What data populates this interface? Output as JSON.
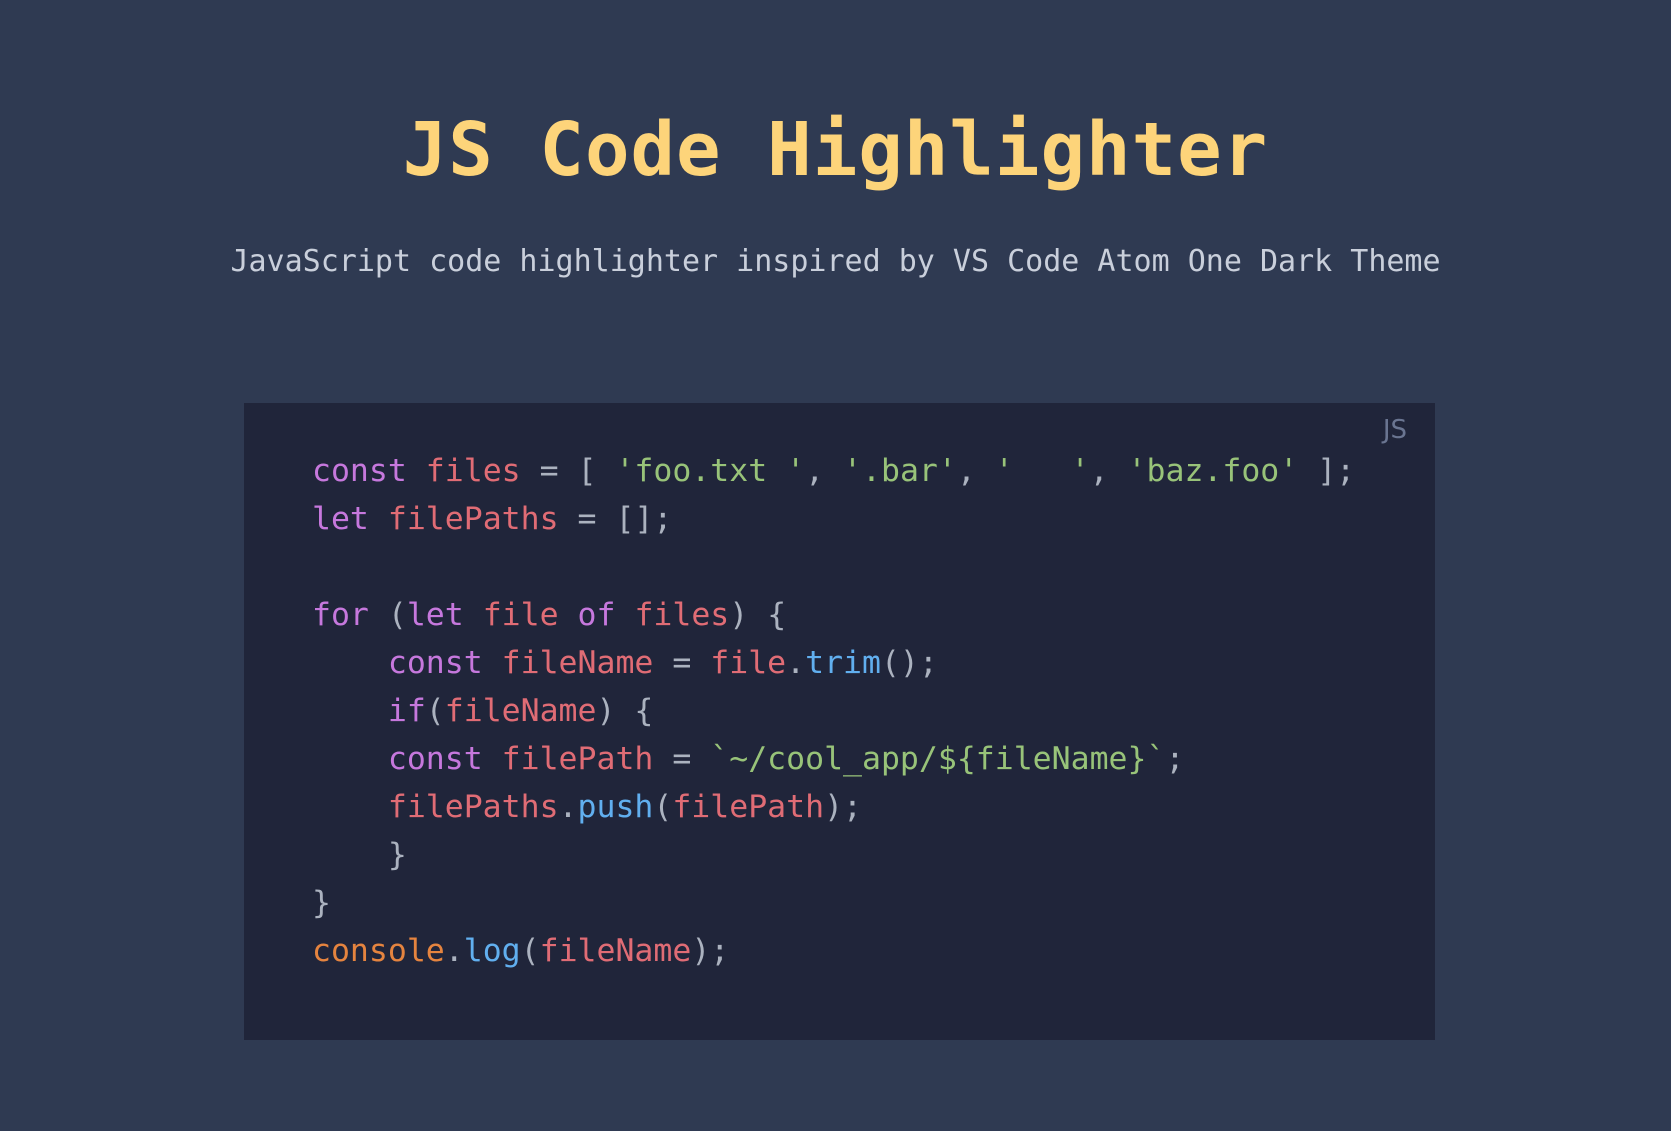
{
  "header": {
    "title": "JS Code Highlighter",
    "subtitle": "JavaScript code highlighter inspired by VS Code Atom One Dark Theme"
  },
  "code_block": {
    "language": "JS",
    "lines": [
      [
        {
          "t": "const",
          "c": "kw"
        },
        {
          "t": " ",
          "c": "pun"
        },
        {
          "t": "files",
          "c": "var"
        },
        {
          "t": " = [ ",
          "c": "pun"
        },
        {
          "t": "'foo.txt '",
          "c": "str"
        },
        {
          "t": ", ",
          "c": "pun"
        },
        {
          "t": "'.bar'",
          "c": "str"
        },
        {
          "t": ", ",
          "c": "pun"
        },
        {
          "t": "'   '",
          "c": "str"
        },
        {
          "t": ", ",
          "c": "pun"
        },
        {
          "t": "'baz.foo'",
          "c": "str"
        },
        {
          "t": " ];",
          "c": "pun"
        }
      ],
      [
        {
          "t": "let",
          "c": "kw"
        },
        {
          "t": " ",
          "c": "pun"
        },
        {
          "t": "filePaths",
          "c": "var"
        },
        {
          "t": " = [];",
          "c": "pun"
        }
      ],
      [],
      [
        {
          "t": "for",
          "c": "kw"
        },
        {
          "t": " (",
          "c": "pun"
        },
        {
          "t": "let",
          "c": "kw"
        },
        {
          "t": " ",
          "c": "pun"
        },
        {
          "t": "file",
          "c": "var"
        },
        {
          "t": " ",
          "c": "pun"
        },
        {
          "t": "of",
          "c": "kw"
        },
        {
          "t": " ",
          "c": "pun"
        },
        {
          "t": "files",
          "c": "var"
        },
        {
          "t": ") {",
          "c": "pun"
        }
      ],
      [
        {
          "t": "    ",
          "c": "pun"
        },
        {
          "t": "const",
          "c": "kw"
        },
        {
          "t": " ",
          "c": "pun"
        },
        {
          "t": "fileName",
          "c": "var"
        },
        {
          "t": " = ",
          "c": "pun"
        },
        {
          "t": "file",
          "c": "var"
        },
        {
          "t": ".",
          "c": "pun"
        },
        {
          "t": "trim",
          "c": "fn"
        },
        {
          "t": "();",
          "c": "pun"
        }
      ],
      [
        {
          "t": "    ",
          "c": "pun"
        },
        {
          "t": "if",
          "c": "kw"
        },
        {
          "t": "(",
          "c": "pun"
        },
        {
          "t": "fileName",
          "c": "var"
        },
        {
          "t": ") {",
          "c": "pun"
        }
      ],
      [
        {
          "t": "    ",
          "c": "pun"
        },
        {
          "t": "const",
          "c": "kw"
        },
        {
          "t": " ",
          "c": "pun"
        },
        {
          "t": "filePath",
          "c": "var"
        },
        {
          "t": " = ",
          "c": "pun"
        },
        {
          "t": "`~/cool_app/${fileName}`",
          "c": "str"
        },
        {
          "t": ";",
          "c": "pun"
        }
      ],
      [
        {
          "t": "    ",
          "c": "pun"
        },
        {
          "t": "filePaths",
          "c": "var"
        },
        {
          "t": ".",
          "c": "pun"
        },
        {
          "t": "push",
          "c": "fn"
        },
        {
          "t": "(",
          "c": "pun"
        },
        {
          "t": "filePath",
          "c": "var"
        },
        {
          "t": ");",
          "c": "pun"
        }
      ],
      [
        {
          "t": "    }",
          "c": "pun"
        }
      ],
      [
        {
          "t": "}",
          "c": "pun"
        }
      ],
      [
        {
          "t": "console",
          "c": "obj"
        },
        {
          "t": ".",
          "c": "pun"
        },
        {
          "t": "log",
          "c": "fn"
        },
        {
          "t": "(",
          "c": "pun"
        },
        {
          "t": "fileName",
          "c": "var"
        },
        {
          "t": ");",
          "c": "pun"
        }
      ]
    ]
  },
  "colors": {
    "page_background": "#2f3a52",
    "panel_background": "#20253a",
    "title": "#fdd47a",
    "subtitle": "#c9cfdb",
    "keyword": "#c678dd",
    "variable": "#e06c75",
    "string": "#98c379",
    "function": "#61afef",
    "object": "#e5843f",
    "punctuation": "#abb2bf",
    "language_badge": "#6a7591"
  }
}
